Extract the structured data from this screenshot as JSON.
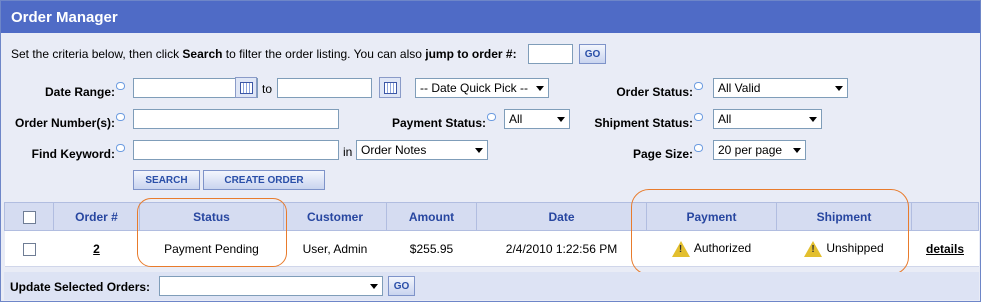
{
  "title": "Order Manager",
  "intro": {
    "before": "Set the criteria below, then click ",
    "search_word": "Search",
    "middle": " to filter the order listing. You can also ",
    "jump_phrase": "jump to order #:",
    "go": "GO"
  },
  "filters": {
    "date_range_label": "Date Range:",
    "to": "to",
    "quick_pick": "-- Date Quick Pick --",
    "order_status_label": "Order Status:",
    "order_status_value": "All Valid",
    "order_numbers_label": "Order Number(s):",
    "payment_status_label": "Payment Status:",
    "payment_status_value": "All",
    "shipment_status_label": "Shipment Status:",
    "shipment_status_value": "All",
    "find_keyword_label": "Find Keyword:",
    "in": "in",
    "keyword_field": "Order Notes",
    "page_size_label": "Page Size:",
    "page_size_value": "20 per page"
  },
  "buttons": {
    "search": "SEARCH",
    "create_order": "CREATE ORDER",
    "go": "GO"
  },
  "table": {
    "columns": [
      "Order #",
      "Status",
      "Customer",
      "Amount",
      "Date",
      "Payment",
      "Shipment"
    ],
    "rows": [
      {
        "order_no": "2",
        "status": "Payment Pending",
        "customer": "User, Admin",
        "amount": "$255.95",
        "date": "2/4/2010 1:22:56 PM",
        "payment": "Authorized",
        "shipment": "Unshipped",
        "action": "details",
        "payment_icon": "warning-icon",
        "shipment_icon": "warning-icon"
      }
    ]
  },
  "footer": {
    "label": "Update Selected Orders:"
  },
  "colors": {
    "title_bar": "#4f6bc6",
    "header_text": "#2746a0",
    "highlight": "#e87b2c"
  }
}
